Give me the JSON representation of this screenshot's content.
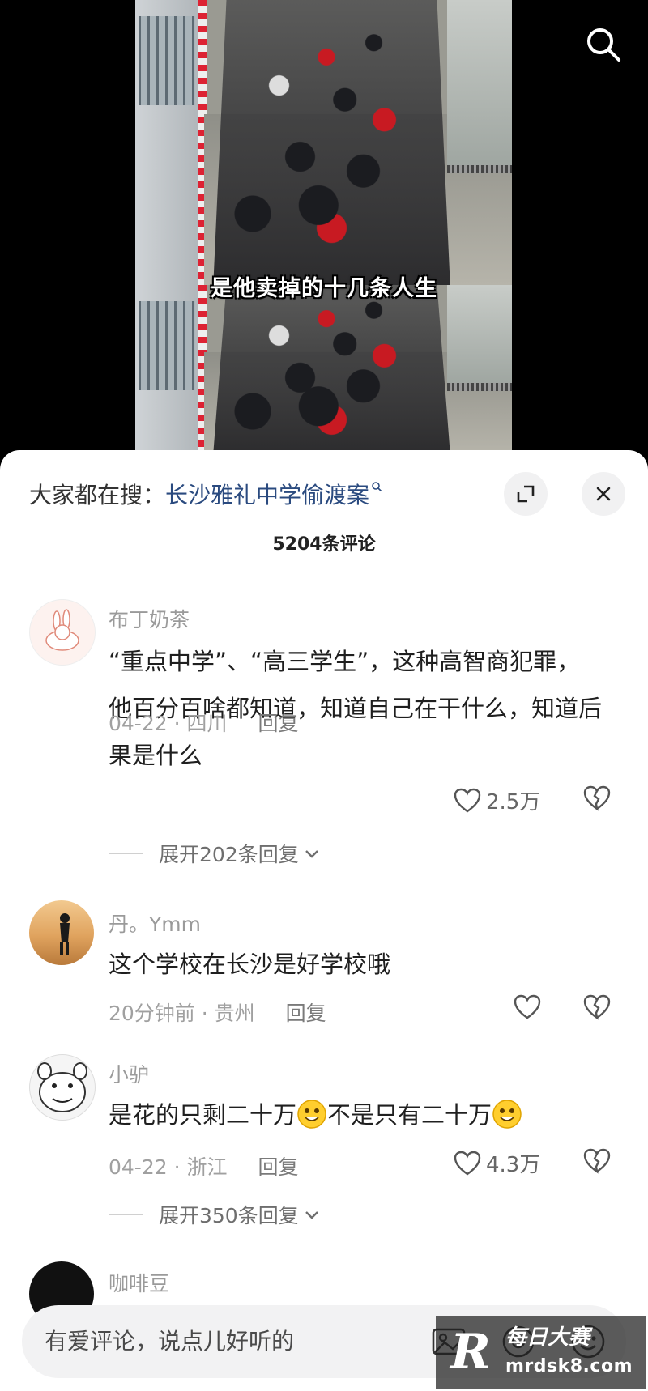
{
  "video": {
    "subtitle": "是他卖掉的十几条人生",
    "search_icon": "search-icon"
  },
  "sheet": {
    "trend_label": "大家都在搜：",
    "trend_link": "长沙雅礼中学偷渡案",
    "trend_link_icon": "search-small-icon",
    "expand_icon": "expand-icon",
    "close_icon": "close-icon",
    "comment_count": "5204条评论"
  },
  "comments": [
    {
      "user": "布丁奶茶",
      "text": "“重点中学”、“高三学生”，这种高智商犯罪，他百分百啥都知道，知道自己在干什么，知道后果是什么",
      "time": "04-22",
      "location": "四川",
      "meta": "04-22 · 四川",
      "reply": "回复",
      "likes": "2.5万",
      "expand": "展开202条回复"
    },
    {
      "user": "丹。Ymm",
      "text": "这个学校在长沙是好学校哦",
      "meta": "20分钟前 · 贵州",
      "reply": "回复",
      "likes": ""
    },
    {
      "user": "小驴",
      "text_a": "是花的只剩二十万",
      "text_b": "不是只有二十万",
      "meta": "04-22 · 浙江",
      "reply": "回复",
      "likes": "4.3万",
      "expand": "展开350条回复"
    },
    {
      "user": "咖啡豆"
    }
  ],
  "input": {
    "placeholder": "有爱评论，说点儿好听的"
  },
  "watermark": {
    "logo": "R",
    "title": "每日大赛",
    "url": "mrdsk8.com"
  },
  "colors": {
    "link": "#2a4a7f",
    "sheet_bg": "#ffffff",
    "video_bg": "#000000"
  }
}
